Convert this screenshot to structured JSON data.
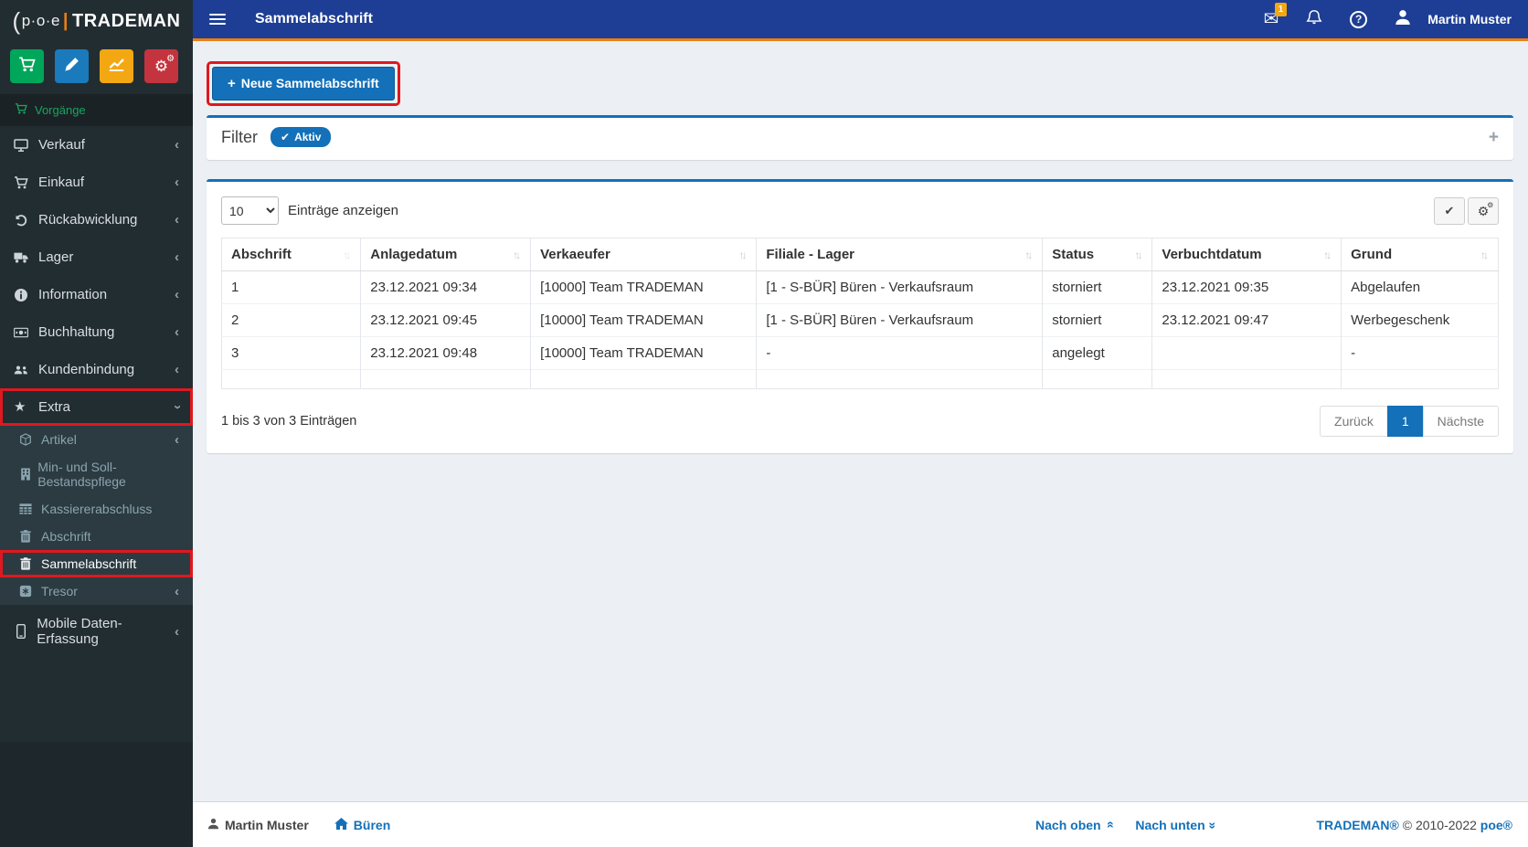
{
  "app": {
    "logo_prefix": "p·o·e",
    "logo_name": "TRADEMAN",
    "accent_orange": "#ec7f12",
    "accent_blue": "#1470b8"
  },
  "topbar": {
    "title": "Sammelabschrift",
    "mail_badge": "1",
    "user_name": "Martin Muster"
  },
  "sidebar": {
    "quick_buttons": [
      {
        "icon": "cart-icon",
        "color": "#00a65a"
      },
      {
        "icon": "pencil-icon",
        "color": "#1a7abc"
      },
      {
        "icon": "chart-line-icon",
        "color": "#f3a712"
      },
      {
        "icon": "gears-icon",
        "color": "#c4343e"
      }
    ],
    "section_header": "Vorgänge",
    "items": [
      {
        "label": "Verkauf",
        "icon": "desktop-icon"
      },
      {
        "label": "Einkauf",
        "icon": "cart-icon"
      },
      {
        "label": "Rückabwicklung",
        "icon": "undo-icon"
      },
      {
        "label": "Lager",
        "icon": "truck-icon"
      },
      {
        "label": "Information",
        "icon": "info-circle-icon"
      },
      {
        "label": "Buchhaltung",
        "icon": "money-icon"
      },
      {
        "label": "Kundenbindung",
        "icon": "users-icon"
      },
      {
        "label": "Extra",
        "icon": "star-icon",
        "expanded": true
      }
    ],
    "submenu": [
      {
        "label": "Artikel",
        "icon": "cube-icon",
        "has_chevron": true
      },
      {
        "label": "Min- und Soll-Bestandspflege",
        "icon": "building-icon"
      },
      {
        "label": "Kassiererabschluss",
        "icon": "table-grid-icon"
      },
      {
        "label": "Abschrift",
        "icon": "trash-icon"
      },
      {
        "label": "Sammelabschrift",
        "icon": "trash-icon",
        "active": true
      },
      {
        "label": "Tresor",
        "icon": "safe-icon",
        "has_chevron": true
      }
    ],
    "items_after": [
      {
        "label": "Mobile Daten-Erfassung",
        "icon": "mobile-icon",
        "has_chevron": true
      }
    ]
  },
  "content": {
    "new_button_label": "Neue Sammelabschrift",
    "filter": {
      "title": "Filter",
      "badge": "Aktiv"
    },
    "length_menu": {
      "selected": "10",
      "label": "Einträge anzeigen"
    },
    "table": {
      "columns": [
        "Abschrift",
        "Anlagedatum",
        "Verkaeufer",
        "Filiale - Lager",
        "Status",
        "Verbuchtdatum",
        "Grund"
      ],
      "rows": [
        [
          "1",
          "23.12.2021 09:34",
          "[10000] Team TRADEMAN",
          "[1 - S-BÜR] Büren - Verkaufsraum",
          "storniert",
          "23.12.2021 09:35",
          "Abgelaufen"
        ],
        [
          "2",
          "23.12.2021 09:45",
          "[10000] Team TRADEMAN",
          "[1 - S-BÜR] Büren - Verkaufsraum",
          "storniert",
          "23.12.2021 09:47",
          "Werbegeschenk"
        ],
        [
          "3",
          "23.12.2021 09:48",
          "[10000] Team TRADEMAN",
          "-",
          "angelegt",
          "",
          "-"
        ]
      ],
      "info": "1 bis 3 von 3 Einträgen",
      "pagination": {
        "prev": "Zurück",
        "page": "1",
        "next": "Nächste"
      }
    }
  },
  "footer": {
    "user": "Martin Muster",
    "location": "Büren",
    "nach_oben": "Nach oben",
    "nach_unten": "Nach unten",
    "copyright_brand": "TRADEMAN®",
    "copyright_years": "© 2010-2022",
    "copyright_company": "poe®"
  }
}
